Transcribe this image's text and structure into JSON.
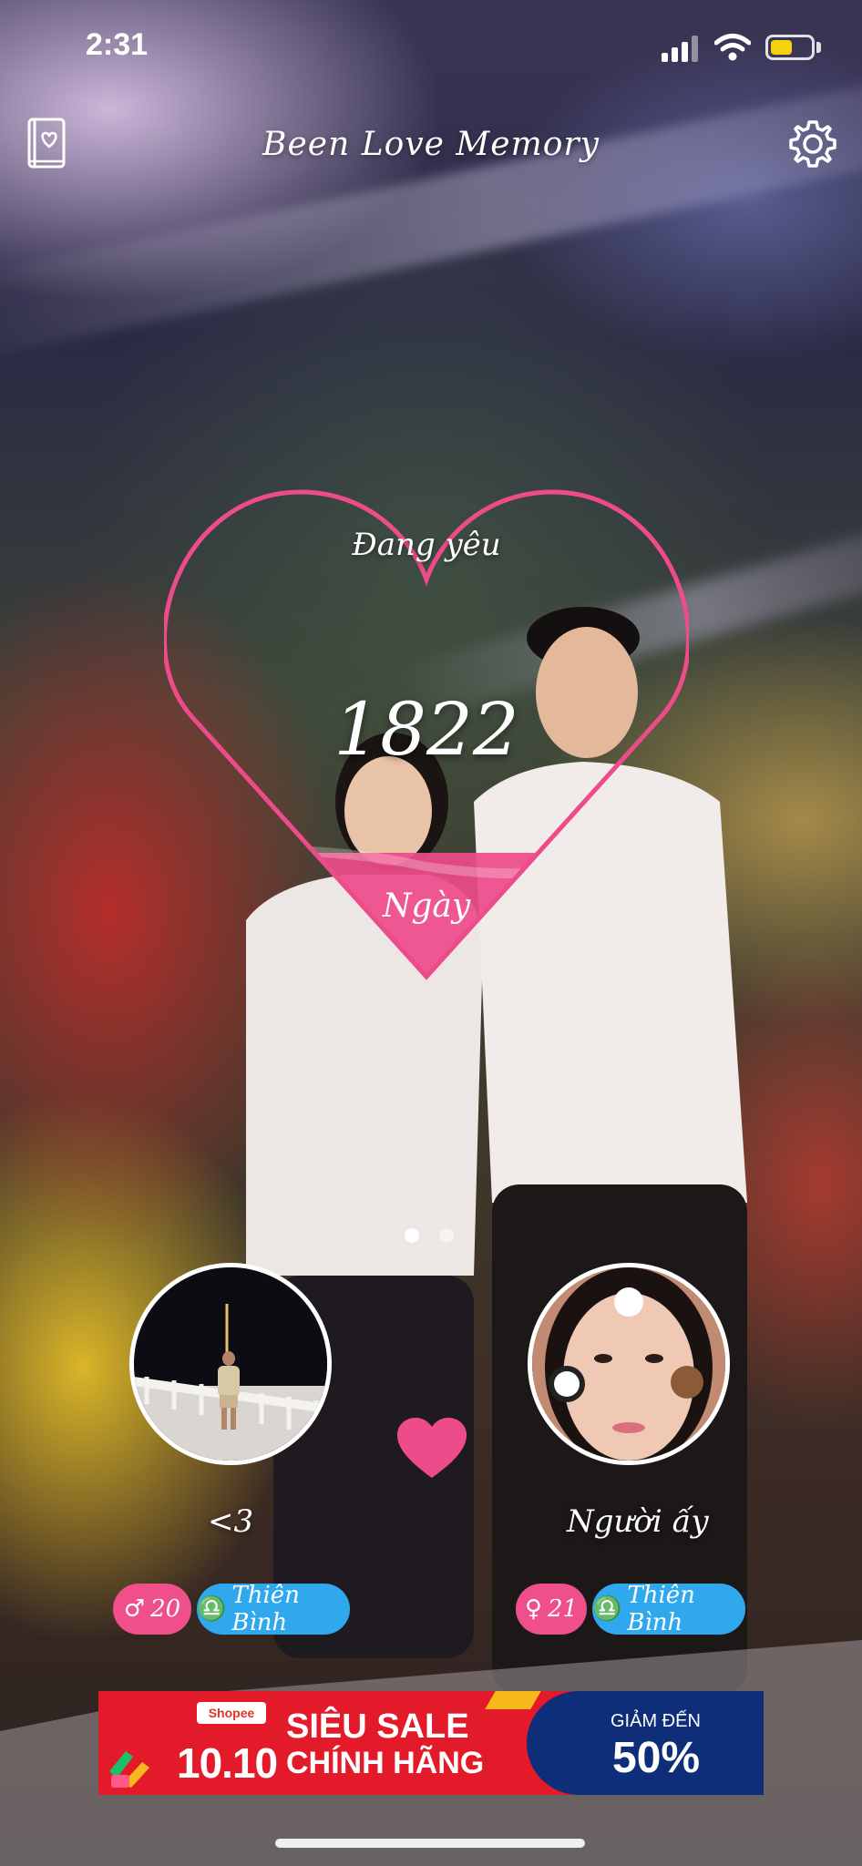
{
  "status_bar": {
    "time": "2:31",
    "battery_level": 0.55,
    "battery_color": "#f5d20c"
  },
  "header": {
    "title": "Been Love Memory",
    "left_icon": "book-heart-icon",
    "right_icon": "gear-icon"
  },
  "counter": {
    "label": "Đang yêu",
    "days": "1822",
    "unit": "Ngày",
    "heart_color": "#ee4b8a"
  },
  "pager": {
    "count": 2,
    "active_index": 0
  },
  "partners": {
    "left": {
      "nickname": "<3",
      "age": "20",
      "gender_symbol": "♂",
      "zodiac_symbol": "♎",
      "zodiac": "Thiên Bình"
    },
    "right": {
      "nickname": "Người ấy",
      "age": "21",
      "gender_symbol": "♀",
      "zodiac_symbol": "♎",
      "zodiac": "Thiên Bình"
    }
  },
  "ad": {
    "brand": "Shopee",
    "date": "10.10",
    "line1": "SIÊU SALE",
    "line2": "CHÍNH HÃNG",
    "discount_label": "GIẢM ĐẾN",
    "discount_value": "50%"
  },
  "colors": {
    "accent_pink": "#ef4f8b",
    "zodiac_blue": "#2fa8ee"
  }
}
